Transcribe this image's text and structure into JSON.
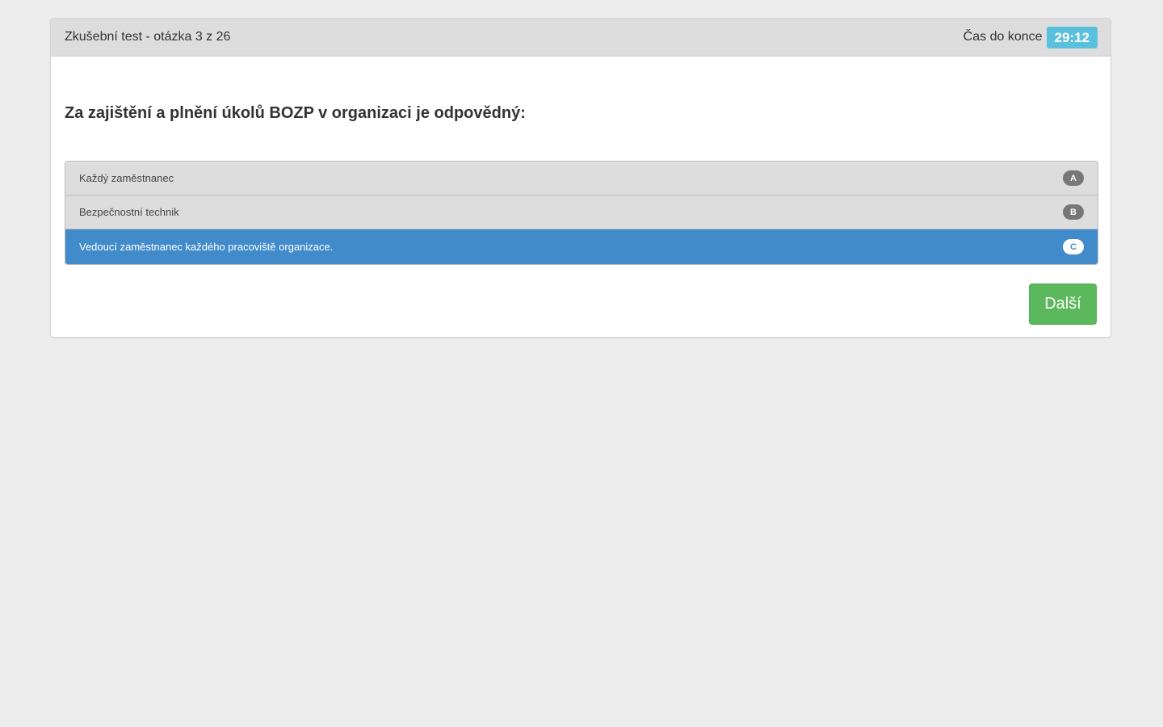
{
  "header": {
    "title": "Zkušební test - otázka 3 z 26",
    "timer_label": "Čas do konce",
    "timer_value": "29:12"
  },
  "question": {
    "text": "Za zajištění a plnění úkolů BOZP v organizaci je odpovědný:"
  },
  "answers": [
    {
      "text": "Každý zaměstnanec",
      "letter": "A",
      "selected": false
    },
    {
      "text": "Bezpečnostní technik",
      "letter": "B",
      "selected": false
    },
    {
      "text": "Vedoucí zaměstnanec každého pracoviště organizace.",
      "letter": "C",
      "selected": true
    }
  ],
  "actions": {
    "next_label": "Další"
  },
  "colors": {
    "selected": "#428bca",
    "timer_badge": "#5bc0de",
    "next_button": "#5cb85c"
  }
}
